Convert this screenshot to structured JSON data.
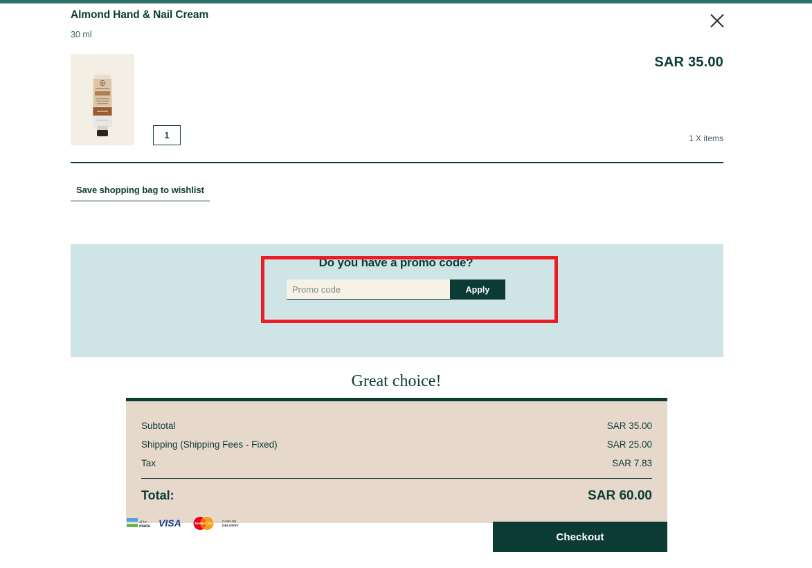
{
  "theme": {
    "accent_teal": "#2e7168",
    "dark_green": "#0c3b36",
    "promo_bg": "#cee4e6",
    "summary_bg": "#e7d8cc",
    "input_bg": "#f7f1e6",
    "thumb_bg": "#f4efe4",
    "highlight_red": "#ec1c24"
  },
  "header": {
    "close_icon": "close-icon"
  },
  "product": {
    "title": "Almond Hand & Nail Cream",
    "size": "30 ml",
    "quantity": "1",
    "price": "SAR 35.00",
    "items_label": "1 X items",
    "image_alt": "almond-hand-nail-cream-tube"
  },
  "wishlist": {
    "label": "Save shopping bag to wishlist"
  },
  "promo": {
    "heading": "Do you have a promo code?",
    "placeholder": "Promo code",
    "value": "",
    "apply_label": "Apply"
  },
  "summary": {
    "heading": "Great choice!",
    "rows": [
      {
        "label": "Subtotal",
        "value": "SAR 35.00"
      },
      {
        "label": "Shipping (Shipping Fees - Fixed)",
        "value": "SAR 25.00"
      },
      {
        "label": "Tax",
        "value": "SAR 7.83"
      }
    ],
    "total": {
      "label": "Total:",
      "value": "SAR 60.00"
    }
  },
  "payments": [
    {
      "name": "mada-icon",
      "label": "mada"
    },
    {
      "name": "visa-icon",
      "label": "VISA"
    },
    {
      "name": "mastercard-icon",
      "label": "MasterCard"
    },
    {
      "name": "cash-on-delivery-icon",
      "label": "CASH ON DELIVERY"
    }
  ],
  "checkout": {
    "label": "Checkout"
  }
}
